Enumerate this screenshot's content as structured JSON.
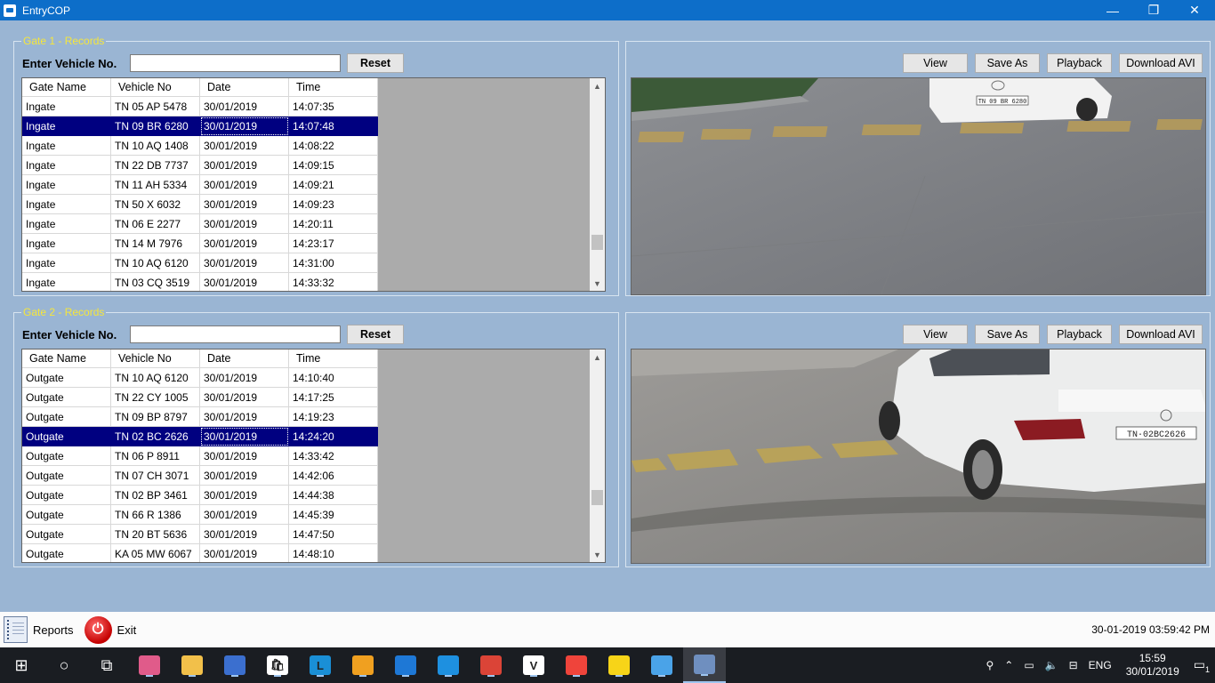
{
  "window": {
    "title": "EntryCOP",
    "minimize": "—",
    "maximize": "❐",
    "close": "✕"
  },
  "gates": [
    {
      "legend": "Gate 1 - Records",
      "search_label": "Enter Vehicle No.",
      "search_value": "",
      "reset_label": "Reset",
      "columns": [
        "Gate Name",
        "Vehicle No",
        "Date",
        "Time"
      ],
      "selected_row": 1,
      "rows": [
        [
          "Ingate",
          "TN 05 AP 5478",
          "30/01/2019",
          "14:07:35"
        ],
        [
          "Ingate",
          "TN 09 BR 6280",
          "30/01/2019",
          "14:07:48"
        ],
        [
          "Ingate",
          "TN 10 AQ 1408",
          "30/01/2019",
          "14:08:22"
        ],
        [
          "Ingate",
          "TN 22 DB 7737",
          "30/01/2019",
          "14:09:15"
        ],
        [
          "Ingate",
          "TN 11 AH 5334",
          "30/01/2019",
          "14:09:21"
        ],
        [
          "Ingate",
          "TN 50 X 6032",
          "30/01/2019",
          "14:09:23"
        ],
        [
          "Ingate",
          "TN 06 E 2277",
          "30/01/2019",
          "14:20:11"
        ],
        [
          "Ingate",
          "TN 14 M 7976",
          "30/01/2019",
          "14:23:17"
        ],
        [
          "Ingate",
          "TN 10 AQ 6120",
          "30/01/2019",
          "14:31:00"
        ],
        [
          "Ingate",
          "TN 03 CQ 3519",
          "30/01/2019",
          "14:33:32"
        ]
      ],
      "camera": {
        "view": "View",
        "save_as": "Save As",
        "playback": "Playback",
        "download": "Download AVI",
        "plate_text": "TN 09 BR 6280"
      }
    },
    {
      "legend": "Gate 2 - Records",
      "search_label": "Enter Vehicle No.",
      "search_value": "",
      "reset_label": "Reset",
      "columns": [
        "Gate Name",
        "Vehicle No",
        "Date",
        "Time"
      ],
      "selected_row": 3,
      "rows": [
        [
          "Outgate",
          "TN 10 AQ 6120",
          "30/01/2019",
          "14:10:40"
        ],
        [
          "Outgate",
          "TN 22 CY 1005",
          "30/01/2019",
          "14:17:25"
        ],
        [
          "Outgate",
          "TN 09 BP 8797",
          "30/01/2019",
          "14:19:23"
        ],
        [
          "Outgate",
          "TN 02 BC 2626",
          "30/01/2019",
          "14:24:20"
        ],
        [
          "Outgate",
          "TN 06 P 8911",
          "30/01/2019",
          "14:33:42"
        ],
        [
          "Outgate",
          "TN 07 CH 3071",
          "30/01/2019",
          "14:42:06"
        ],
        [
          "Outgate",
          "TN 02 BP 3461",
          "30/01/2019",
          "14:44:38"
        ],
        [
          "Outgate",
          "TN 66 R 1386",
          "30/01/2019",
          "14:45:39"
        ],
        [
          "Outgate",
          "TN 20 BT 5636",
          "30/01/2019",
          "14:47:50"
        ],
        [
          "Outgate",
          "KA 05 MW 6067",
          "30/01/2019",
          "14:48:10"
        ]
      ],
      "camera": {
        "view": "View",
        "save_as": "Save As",
        "playback": "Playback",
        "download": "Download AVI",
        "plate_text": "TN·02BC2626"
      }
    }
  ],
  "bottom": {
    "reports_label": "Reports",
    "exit_label": "Exit",
    "datetime": "30-01-2019 03:59:42 PM"
  },
  "taskbar": {
    "icons": [
      {
        "name": "start-icon",
        "color": "#ffffff"
      },
      {
        "name": "search-icon",
        "color": "#ffffff"
      },
      {
        "name": "task-view-icon",
        "color": "#ffffff"
      },
      {
        "name": "paint-icon",
        "color": "#e05b8a"
      },
      {
        "name": "file-explorer-icon",
        "color": "#f2c04a"
      },
      {
        "name": "network-app-icon",
        "color": "#3b6fcf"
      },
      {
        "name": "store-icon",
        "color": "#ffffff"
      },
      {
        "name": "l-app-icon",
        "color": "#1a8fd6"
      },
      {
        "name": "outlook-icon",
        "color": "#f0a020"
      },
      {
        "name": "edge-icon",
        "color": "#1e78d6"
      },
      {
        "name": "internet-explorer-icon",
        "color": "#1e90e0"
      },
      {
        "name": "chrome-icon",
        "color": "#db4437"
      },
      {
        "name": "vnc-icon",
        "color": "#ffffff"
      },
      {
        "name": "anydesk-icon",
        "color": "#ef443b"
      },
      {
        "name": "sticky-notes-icon",
        "color": "#f7d418"
      },
      {
        "name": "remote-desktop-icon",
        "color": "#4aa3e8"
      },
      {
        "name": "entrycop-icon",
        "color": "#6f8fbf"
      }
    ],
    "tray": {
      "lang": "ENG",
      "time": "15:59",
      "date": "30/01/2019",
      "notifications": "1"
    }
  }
}
